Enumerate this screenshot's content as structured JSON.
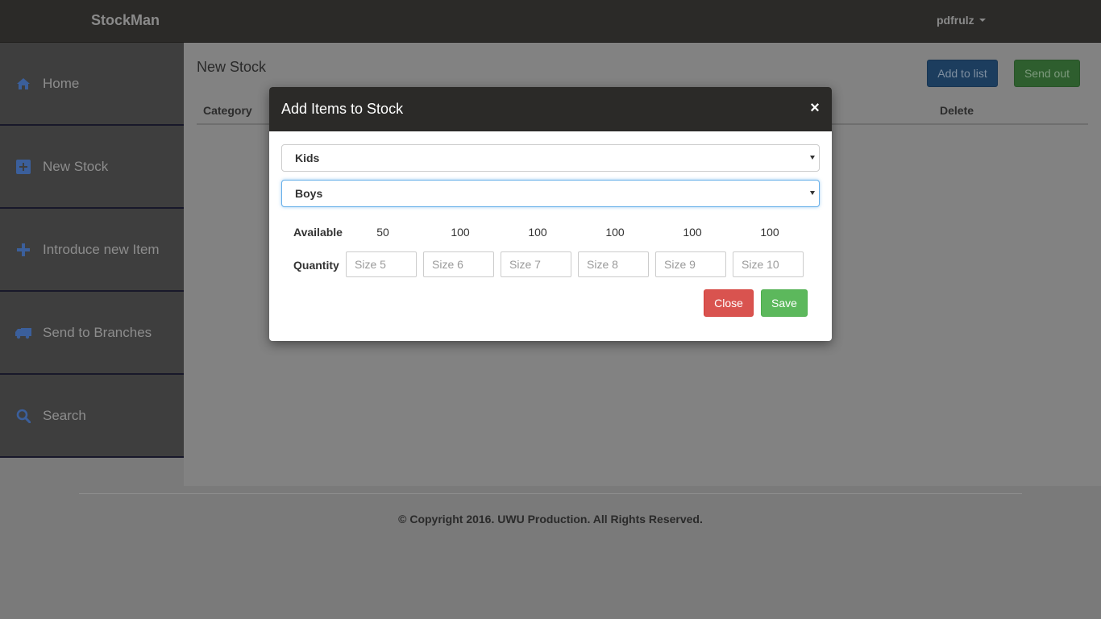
{
  "navbar": {
    "brand": "StockMan",
    "user": "pdfrulz"
  },
  "sidebar": {
    "items": [
      {
        "label": "Home",
        "icon": "home-icon"
      },
      {
        "label": "New Stock",
        "icon": "plus-square-icon"
      },
      {
        "label": "Introduce new Item",
        "icon": "plus-icon"
      },
      {
        "label": "Send to Branches",
        "icon": "truck-icon"
      },
      {
        "label": "Search",
        "icon": "search-icon"
      }
    ]
  },
  "main": {
    "title": "New Stock",
    "add_to_list_label": "Add to list",
    "send_out_label": "Send out",
    "table": {
      "columns": [
        "Category",
        "Delete"
      ]
    }
  },
  "modal": {
    "title": "Add Items to Stock",
    "close_symbol": "×",
    "category_value": "Kids",
    "subcategory_value": "Boys",
    "available_label": "Available",
    "quantity_label": "Quantity",
    "available": [
      "50",
      "100",
      "100",
      "100",
      "100",
      "100"
    ],
    "size_placeholders": [
      "Size 5",
      "Size 6",
      "Size 7",
      "Size 8",
      "Size 9",
      "Size 10"
    ],
    "close_label": "Close",
    "save_label": "Save"
  },
  "footer": {
    "text": "© Copyright 2016. UWU Production. All Rights Reserved."
  },
  "colors": {
    "navbar_bg": "#2b2a28",
    "sidebar_bg": "#3e3e3e",
    "sidebar_icon": "#3b5f9b",
    "primary_button": "#1c3d5e",
    "success_button": "#5cb85c",
    "danger_button": "#d9534f"
  }
}
